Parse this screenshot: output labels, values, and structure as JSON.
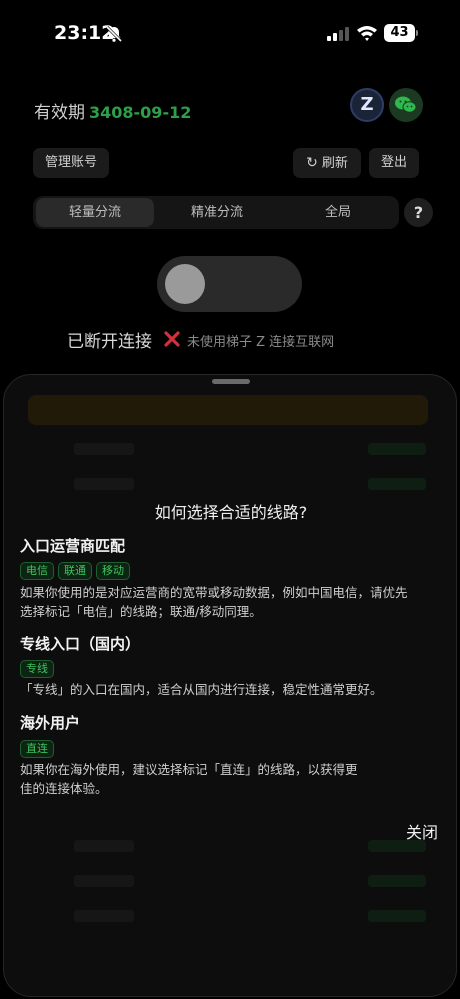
{
  "status_bar": {
    "time": "23:12",
    "battery": "43"
  },
  "header": {
    "validity_label": "有效期",
    "validity_date": "3408-09-12",
    "manage_account": "管理账号",
    "refresh": "刷新",
    "logout": "登出",
    "z_icon_letter": "Z"
  },
  "modes": {
    "tabs": [
      "轻量分流",
      "精准分流",
      "全局"
    ],
    "help": "?"
  },
  "connection": {
    "status": "已断开连接",
    "note": "未使用梯子 Z 连接互联网"
  },
  "sheet": {
    "title": "如何选择合适的线路?",
    "sections": [
      {
        "title": "入口运营商匹配",
        "tags": [
          "电信",
          "联通",
          "移动"
        ],
        "desc_lines": [
          "如果你使用的是对应运营商的宽带或移动数据，例如中国电信，请优先",
          "选择标记「电信」的线路；联通/移动同理。"
        ]
      },
      {
        "title": "专线入口（国内）",
        "tags": [
          "专线"
        ],
        "desc_lines": [
          "「专线」的入口在国内，适合从国内进行连接，稳定性通常更好。"
        ]
      },
      {
        "title": "海外用户",
        "tags": [
          "直连"
        ],
        "desc_lines": [
          "如果你在海外使用，建议选择标记「直连」的线路，以获得更",
          "佳的连接体验。"
        ]
      }
    ],
    "close": "关闭"
  },
  "colors": {
    "accent_green": "#2f9e4a",
    "tag_green": "#3fc25e",
    "x_red": "#d3313a"
  }
}
